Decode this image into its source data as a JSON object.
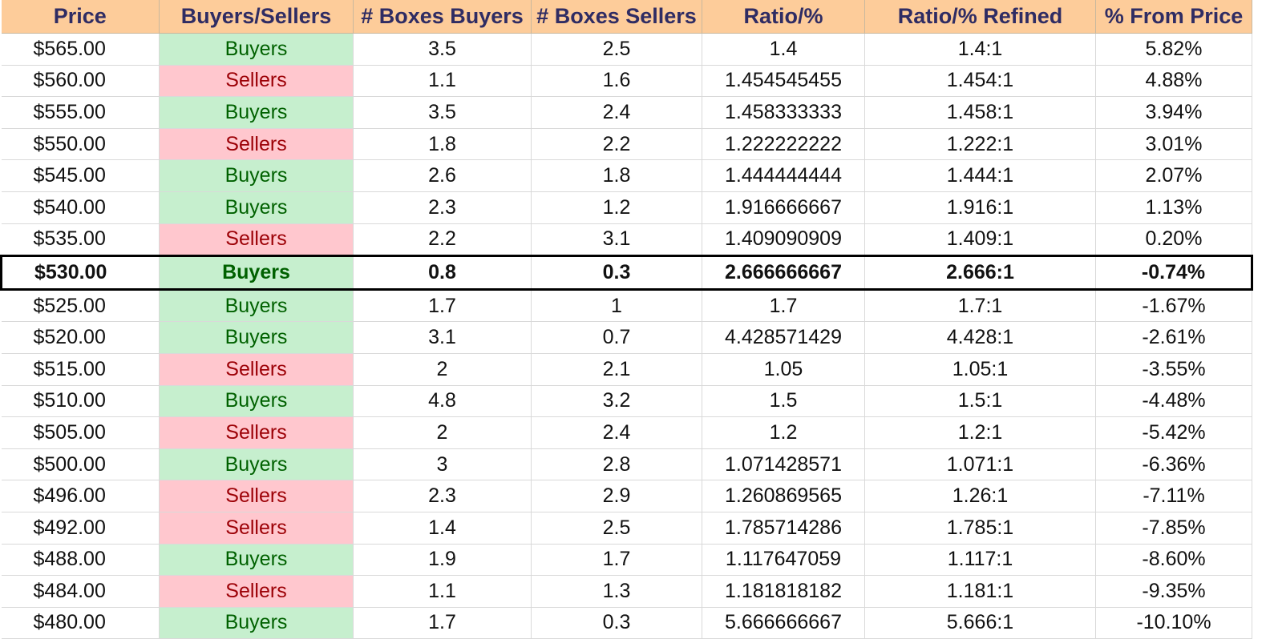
{
  "header": {
    "price": "Price",
    "buyers_sellers": "Buyers/Sellers",
    "boxes_buyers": "# Boxes Buyers",
    "boxes_sellers": "# Boxes Sellers",
    "ratio": "Ratio/%",
    "ratio_refined": "Ratio/% Refined",
    "from_price": "% From Price"
  },
  "colors": {
    "header_bg": "#fdcc9a",
    "header_text": "#2f2c63",
    "buyers_bg": "#c6efce",
    "buyers_text": "#006100",
    "sellers_bg": "#ffc7ce",
    "sellers_text": "#9c0006"
  },
  "current_row_index": 7,
  "rows": [
    {
      "price": "$565.00",
      "side": "Buyers",
      "boxes_buyers": "3.5",
      "boxes_sellers": "2.5",
      "ratio": "1.4",
      "refined": "1.4:1",
      "from_price": "5.82%"
    },
    {
      "price": "$560.00",
      "side": "Sellers",
      "boxes_buyers": "1.1",
      "boxes_sellers": "1.6",
      "ratio": "1.454545455",
      "refined": "1.454:1",
      "from_price": "4.88%"
    },
    {
      "price": "$555.00",
      "side": "Buyers",
      "boxes_buyers": "3.5",
      "boxes_sellers": "2.4",
      "ratio": "1.458333333",
      "refined": "1.458:1",
      "from_price": "3.94%"
    },
    {
      "price": "$550.00",
      "side": "Sellers",
      "boxes_buyers": "1.8",
      "boxes_sellers": "2.2",
      "ratio": "1.222222222",
      "refined": "1.222:1",
      "from_price": "3.01%"
    },
    {
      "price": "$545.00",
      "side": "Buyers",
      "boxes_buyers": "2.6",
      "boxes_sellers": "1.8",
      "ratio": "1.444444444",
      "refined": "1.444:1",
      "from_price": "2.07%"
    },
    {
      "price": "$540.00",
      "side": "Buyers",
      "boxes_buyers": "2.3",
      "boxes_sellers": "1.2",
      "ratio": "1.916666667",
      "refined": "1.916:1",
      "from_price": "1.13%"
    },
    {
      "price": "$535.00",
      "side": "Sellers",
      "boxes_buyers": "2.2",
      "boxes_sellers": "3.1",
      "ratio": "1.409090909",
      "refined": "1.409:1",
      "from_price": "0.20%"
    },
    {
      "price": "$530.00",
      "side": "Buyers",
      "boxes_buyers": "0.8",
      "boxes_sellers": "0.3",
      "ratio": "2.666666667",
      "refined": "2.666:1",
      "from_price": "-0.74%"
    },
    {
      "price": "$525.00",
      "side": "Buyers",
      "boxes_buyers": "1.7",
      "boxes_sellers": "1",
      "ratio": "1.7",
      "refined": "1.7:1",
      "from_price": "-1.67%"
    },
    {
      "price": "$520.00",
      "side": "Buyers",
      "boxes_buyers": "3.1",
      "boxes_sellers": "0.7",
      "ratio": "4.428571429",
      "refined": "4.428:1",
      "from_price": "-2.61%"
    },
    {
      "price": "$515.00",
      "side": "Sellers",
      "boxes_buyers": "2",
      "boxes_sellers": "2.1",
      "ratio": "1.05",
      "refined": "1.05:1",
      "from_price": "-3.55%"
    },
    {
      "price": "$510.00",
      "side": "Buyers",
      "boxes_buyers": "4.8",
      "boxes_sellers": "3.2",
      "ratio": "1.5",
      "refined": "1.5:1",
      "from_price": "-4.48%"
    },
    {
      "price": "$505.00",
      "side": "Sellers",
      "boxes_buyers": "2",
      "boxes_sellers": "2.4",
      "ratio": "1.2",
      "refined": "1.2:1",
      "from_price": "-5.42%"
    },
    {
      "price": "$500.00",
      "side": "Buyers",
      "boxes_buyers": "3",
      "boxes_sellers": "2.8",
      "ratio": "1.071428571",
      "refined": "1.071:1",
      "from_price": "-6.36%"
    },
    {
      "price": "$496.00",
      "side": "Sellers",
      "boxes_buyers": "2.3",
      "boxes_sellers": "2.9",
      "ratio": "1.260869565",
      "refined": "1.26:1",
      "from_price": "-7.11%"
    },
    {
      "price": "$492.00",
      "side": "Sellers",
      "boxes_buyers": "1.4",
      "boxes_sellers": "2.5",
      "ratio": "1.785714286",
      "refined": "1.785:1",
      "from_price": "-7.85%"
    },
    {
      "price": "$488.00",
      "side": "Buyers",
      "boxes_buyers": "1.9",
      "boxes_sellers": "1.7",
      "ratio": "1.117647059",
      "refined": "1.117:1",
      "from_price": "-8.60%"
    },
    {
      "price": "$484.00",
      "side": "Sellers",
      "boxes_buyers": "1.1",
      "boxes_sellers": "1.3",
      "ratio": "1.181818182",
      "refined": "1.181:1",
      "from_price": "-9.35%"
    },
    {
      "price": "$480.00",
      "side": "Buyers",
      "boxes_buyers": "1.7",
      "boxes_sellers": "0.3",
      "ratio": "5.666666667",
      "refined": "5.666:1",
      "from_price": "-10.10%"
    }
  ]
}
